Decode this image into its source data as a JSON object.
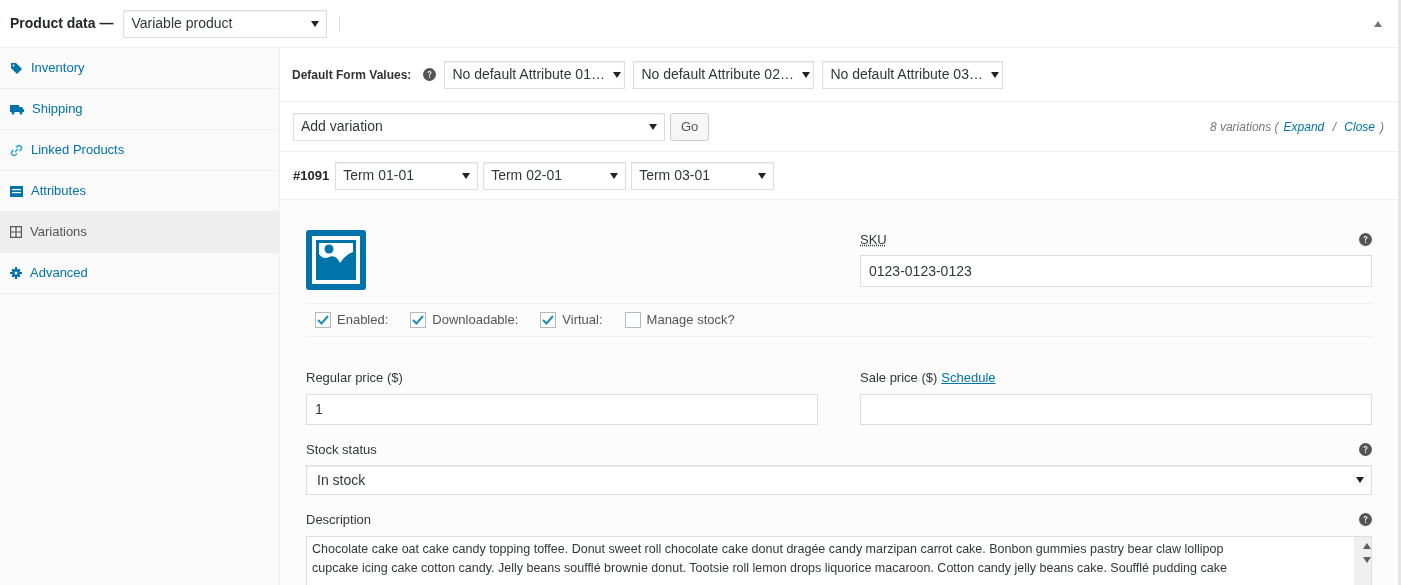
{
  "header": {
    "title": "Product data —",
    "product_type": "Variable product",
    "expanded": true
  },
  "sidebar": {
    "items": [
      {
        "label": "Inventory",
        "selected": false
      },
      {
        "label": "Shipping",
        "selected": false
      },
      {
        "label": "Linked Products",
        "selected": false
      },
      {
        "label": "Attributes",
        "selected": false
      },
      {
        "label": "Variations",
        "selected": true
      },
      {
        "label": "Advanced",
        "selected": false
      }
    ]
  },
  "defaults": {
    "label": "Default Form Values:",
    "selects": [
      "No default Attribute 01…",
      "No default Attribute 02…",
      "No default Attribute 03…"
    ]
  },
  "toolbar": {
    "action": "Add variation",
    "go": "Go",
    "count": "8 variations (",
    "expand": "Expand",
    "sep": " / ",
    "close": "Close",
    "end": ")"
  },
  "variation": {
    "id": "#1091",
    "terms": [
      "Term 01-01",
      "Term 02-01",
      "Term 03-01"
    ],
    "sku": {
      "label": "SKU",
      "value": "0123-0123-0123"
    },
    "options": [
      {
        "label": "Enabled:",
        "checked": true
      },
      {
        "label": "Downloadable:",
        "checked": true
      },
      {
        "label": "Virtual:",
        "checked": true
      },
      {
        "label": "Manage stock?",
        "checked": false
      }
    ],
    "regular_price": {
      "label": "Regular price ($)",
      "value": "1"
    },
    "sale_price": {
      "label": "Sale price ($)",
      "link": "Schedule"
    },
    "stock_status": {
      "label": "Stock status",
      "value": "In stock"
    },
    "description": {
      "label": "Description",
      "lines": [
        "Chocolate cake oat cake candy topping toffee. Donut sweet roll chocolate cake donut dragée candy marzipan carrot cake. Bonbon gummies pastry bear claw lollipop",
        "cupcake icing cake cotton candy. Jelly beans soufflé brownie donut. Tootsie roll lemon drops liquorice macaroon. Cotton candy jelly beans cake. Soufflé pudding cake"
      ]
    }
  }
}
